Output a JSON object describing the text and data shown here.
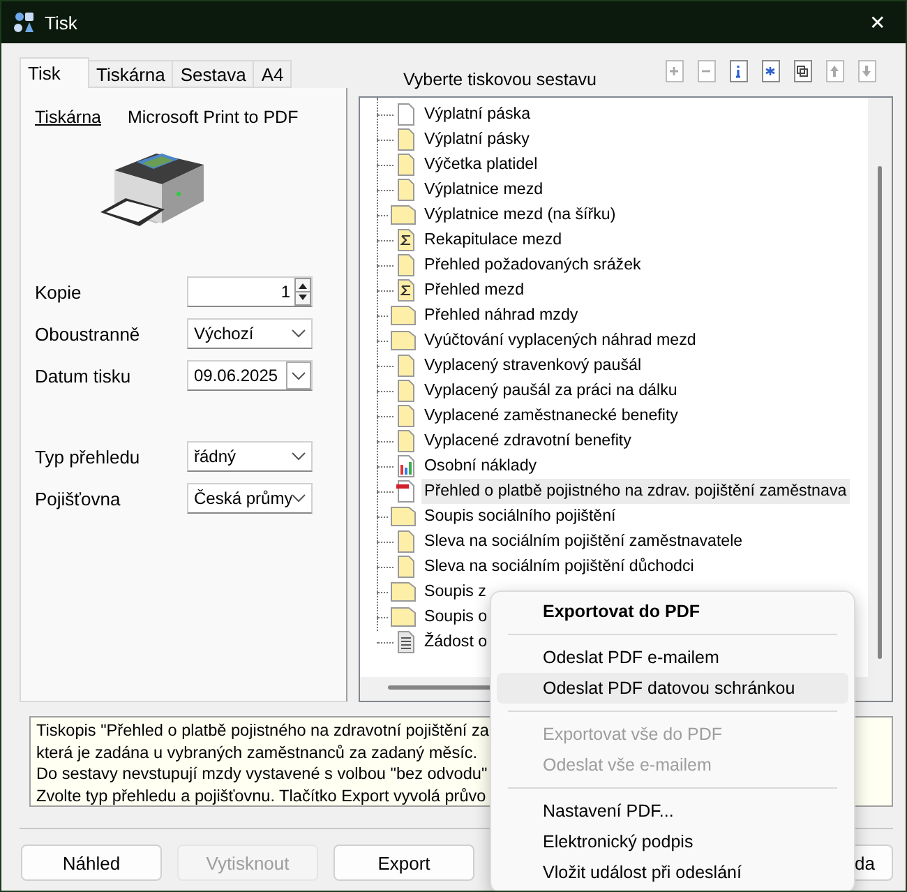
{
  "window": {
    "title": "Tisk",
    "close": "✕"
  },
  "tabs": [
    {
      "label": "Tisk",
      "selected": true
    },
    {
      "label": "Tiskárna",
      "selected": false
    },
    {
      "label": "Sestava",
      "selected": false
    },
    {
      "label": "A4",
      "selected": false
    }
  ],
  "printer": {
    "label": "Tiskárna",
    "value": "Microsoft Print to PDF"
  },
  "form": [
    {
      "kind": "spin",
      "label": "Kopie",
      "value": "1"
    },
    {
      "kind": "select",
      "label": "Oboustranně",
      "value": "Výchozí"
    },
    {
      "kind": "date",
      "label": "Datum tisku",
      "value": "09.06.2025"
    },
    {
      "kind": "gap"
    },
    {
      "kind": "select",
      "label": "Typ přehledu",
      "value": "řádný"
    },
    {
      "kind": "select",
      "label": "Pojišťovna",
      "value": "Česká průmy"
    }
  ],
  "report_header": "Vyberte tiskovou sestavu",
  "toolbar": [
    {
      "kind": "add",
      "disabled": true
    },
    {
      "kind": "remove",
      "disabled": true
    },
    {
      "kind": "info",
      "disabled": false
    },
    {
      "kind": "star",
      "disabled": false
    },
    {
      "kind": "copy",
      "disabled": false
    },
    {
      "kind": "up",
      "disabled": true
    },
    {
      "kind": "down",
      "disabled": true
    }
  ],
  "reports": [
    {
      "label": "Výplatní páska",
      "kind": "blank",
      "selected": false
    },
    {
      "label": "Výplatní pásky",
      "kind": "page",
      "selected": false
    },
    {
      "label": "Výčetka platidel",
      "kind": "page",
      "selected": false
    },
    {
      "label": "Výplatnice mezd",
      "kind": "page",
      "selected": false
    },
    {
      "label": "Výplatnice mezd (na šířku)",
      "kind": "wide",
      "selected": false
    },
    {
      "label": "Rekapitulace mezd",
      "kind": "sum",
      "selected": false
    },
    {
      "label": "Přehled požadovaných srážek",
      "kind": "page",
      "selected": false
    },
    {
      "label": "Přehled mezd",
      "kind": "sum",
      "selected": false
    },
    {
      "label": "Přehled náhrad mzdy",
      "kind": "wide",
      "selected": false
    },
    {
      "label": "Vyúčtování vyplacených náhrad mezd",
      "kind": "wide",
      "selected": false
    },
    {
      "label": "Vyplacený stravenkový paušál",
      "kind": "page",
      "selected": false
    },
    {
      "label": "Vyplacený paušál za práci na dálku",
      "kind": "page",
      "selected": false
    },
    {
      "label": "Vyplacené zaměstnanecké benefity",
      "kind": "page",
      "selected": false
    },
    {
      "label": "Vyplacené zdravotní benefity",
      "kind": "page",
      "selected": false
    },
    {
      "label": "Osobní náklady",
      "kind": "chart",
      "selected": false
    },
    {
      "label": "Přehled o platbě pojistného na zdrav. pojištění zaměstnava",
      "kind": "pdf",
      "selected": true
    },
    {
      "label": "Soupis sociálního pojištění",
      "kind": "wide",
      "selected": false
    },
    {
      "label": "Sleva na sociálním pojištění zaměstnavatele",
      "kind": "page",
      "selected": false
    },
    {
      "label": "Sleva na sociálním pojištění důchodci",
      "kind": "page",
      "selected": false
    },
    {
      "label": "Soupis z",
      "kind": "wide",
      "selected": false
    },
    {
      "label": "Soupis o",
      "kind": "wide",
      "selected": false
    },
    {
      "label": "Žádost o",
      "kind": "text",
      "selected": false
    }
  ],
  "description": [
    "Tiskopis \"Přehled o platbě pojistného na zdravotní pojištění za",
    "která je zadána u vybraných zaměstnanců za zadaný měsíc.",
    "Do sestavy nevstupují mzdy vystavené s volbou \"bez odvodu\"",
    "Zvolte typ přehledu a pojišťovnu. Tlačítko Export vyvolá průvo"
  ],
  "buttons": [
    {
      "label": "Náhled",
      "disabled": false
    },
    {
      "label": "Vytisknout",
      "disabled": true
    },
    {
      "label": "Export",
      "disabled": false
    },
    {
      "label": "da",
      "disabled": false
    }
  ],
  "context_menu": [
    [
      {
        "label": "Exportovat do PDF",
        "bold": true,
        "disabled": false,
        "selected": false
      }
    ],
    [
      {
        "label": "Odeslat PDF e-mailem",
        "bold": false,
        "disabled": false,
        "selected": false
      },
      {
        "label": "Odeslat PDF datovou schránkou",
        "bold": false,
        "disabled": false,
        "selected": true
      }
    ],
    [
      {
        "label": "Exportovat vše do PDF",
        "bold": false,
        "disabled": true,
        "selected": false
      },
      {
        "label": "Odeslat vše e-mailem",
        "bold": false,
        "disabled": true,
        "selected": false
      }
    ],
    [
      {
        "label": "Nastavení PDF...",
        "bold": false,
        "disabled": false,
        "selected": false
      },
      {
        "label": "Elektronický podpis",
        "bold": false,
        "disabled": false,
        "selected": false
      },
      {
        "label": "Vložit událost při odeslání",
        "bold": false,
        "disabled": false,
        "selected": false
      }
    ]
  ]
}
